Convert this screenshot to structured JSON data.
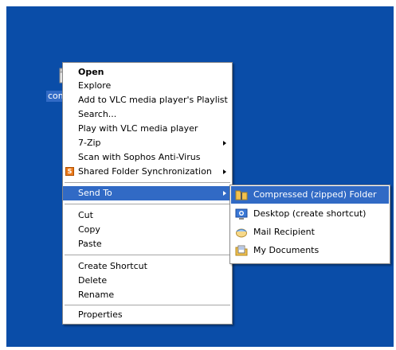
{
  "desktop": {
    "icon_label": "comp"
  },
  "context_menu": {
    "items": [
      {
        "label": "Open"
      },
      {
        "label": "Explore"
      },
      {
        "label": "Add to VLC media player's Playlist"
      },
      {
        "label": "Search..."
      },
      {
        "label": "Play with VLC media player"
      },
      {
        "label": "7-Zip"
      },
      {
        "label": "Scan with Sophos Anti-Virus"
      },
      {
        "label": "Shared Folder Synchronization",
        "icon": "sync-icon"
      },
      {
        "label": "Send To"
      },
      {
        "label": "Cut"
      },
      {
        "label": "Copy"
      },
      {
        "label": "Paste"
      },
      {
        "label": "Create Shortcut"
      },
      {
        "label": "Delete"
      },
      {
        "label": "Rename"
      },
      {
        "label": "Properties"
      }
    ],
    "sync_icon_letter": "S",
    "selected_item": "Send To"
  },
  "sendto_menu": {
    "items": [
      {
        "label": "Compressed (zipped) Folder",
        "icon": "zip-folder-icon"
      },
      {
        "label": "Desktop (create shortcut)",
        "icon": "desktop-icon"
      },
      {
        "label": "Mail Recipient",
        "icon": "mail-icon"
      },
      {
        "label": "My Documents",
        "icon": "documents-icon"
      }
    ],
    "selected_item": "Compressed (zipped) Folder"
  },
  "colors": {
    "desktop_background": "#0A4DA8",
    "selection": "#316AC5"
  }
}
